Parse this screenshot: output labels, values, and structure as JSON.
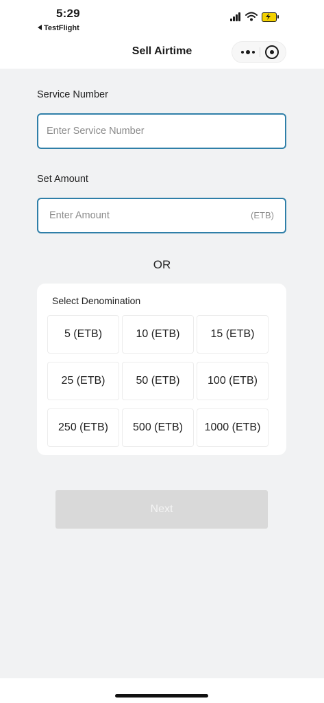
{
  "status_bar": {
    "time": "5:29",
    "back_app": "TestFlight"
  },
  "header": {
    "title": "Sell Airtime"
  },
  "form": {
    "service_label": "Service Number",
    "service_placeholder": "Enter Service Number",
    "amount_label": "Set Amount",
    "amount_placeholder": "Enter Amount",
    "amount_unit": "(ETB)",
    "or_text": "OR"
  },
  "denominations": {
    "title": "Select Denomination",
    "options": [
      "5 (ETB)",
      "10 (ETB)",
      "15 (ETB)",
      "25 (ETB)",
      "50 (ETB)",
      "100 (ETB)",
      "250 (ETB)",
      "500 (ETB)",
      "1000 (ETB)"
    ]
  },
  "actions": {
    "next_label": "Next"
  },
  "colors": {
    "accent_border": "#2f7fa8",
    "page_background": "#f1f2f3",
    "disabled_button": "#d9d9d9",
    "battery_charging": "#f3d100"
  },
  "icons": {
    "signal": "cellular-signal-icon",
    "wifi": "wifi-icon",
    "battery": "battery-charging-icon",
    "more": "more-dots-icon",
    "close": "target-circle-icon"
  }
}
